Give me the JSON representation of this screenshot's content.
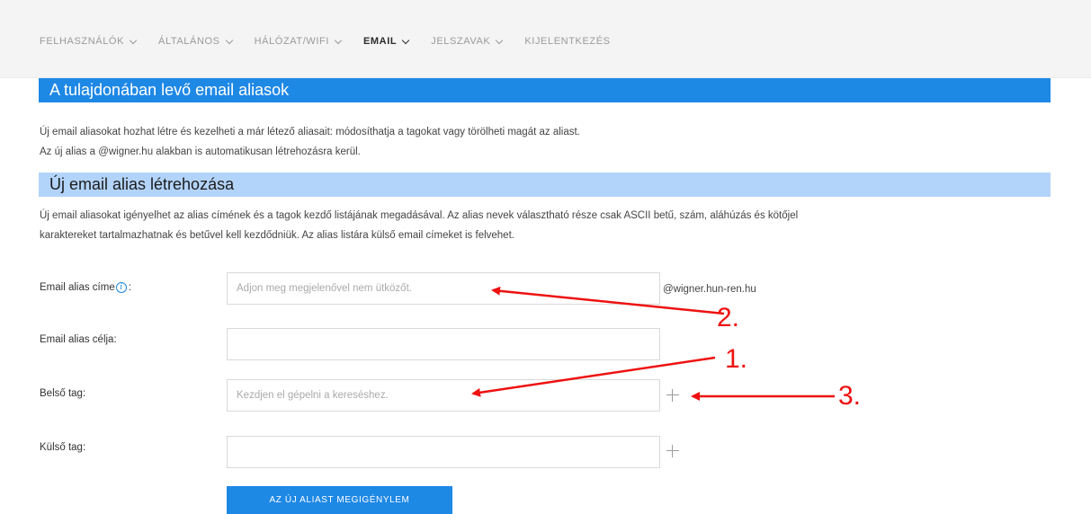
{
  "nav": {
    "items": [
      {
        "label": "FELHASZNÁLÓK",
        "active": false
      },
      {
        "label": "ÁLTALÁNOS",
        "active": false
      },
      {
        "label": "HÁLÓZAT/WIFI",
        "active": false
      },
      {
        "label": "EMAIL",
        "active": true
      },
      {
        "label": "JELSZAVAK",
        "active": false
      }
    ],
    "logout": "KIJELENTKEZÉS"
  },
  "section1": {
    "title": "A tulajdonában levő email aliasok",
    "desc1": "Új email aliasokat hozhat létre és kezelheti a már létező aliasait: módosíthatja a tagokat vagy törölheti magát az aliast.",
    "desc2": "Az új alias a @wigner.hu alakban is automatikusan létrehozásra kerül."
  },
  "section2": {
    "title": "Új email alias létrehozása",
    "desc1": "Új email aliasokat igényelhet az alias címének és a tagok kezdő listájának megadásával. Az alias nevek választható része csak ASCII betű, szám, aláhúzás és kötőjel",
    "desc2": "karaktereket tartalmazhatnak és betűvel kell kezdődniük. Az alias listára külső email címeket is felvehet."
  },
  "form": {
    "alias_label": "Email alias címe",
    "alias_label_colon": ":",
    "info_icon": "i",
    "alias_placeholder": "Adjon meg megjelenővel nem ütközőt.",
    "alias_value": "",
    "domain_suffix": "@wigner.hun-ren.hu",
    "purpose_label": "Email alias célja:",
    "purpose_value": "",
    "internal_label": "Belső tag:",
    "internal_placeholder": "Kezdjen el gépelni a kereséshez.",
    "internal_value": "",
    "external_label": "Külső tag:",
    "external_value": "",
    "submit_label": "AZ ÚJ ALIAST MEGIGÉNYLEM"
  },
  "annotations": {
    "label_1": "1.",
    "label_2": "2.",
    "label_3": "3."
  },
  "colors": {
    "primary": "#1e88e5",
    "light_bar": "#b3d4fa",
    "annotation": "#ee1111"
  },
  "icons": [
    "chevron-down-icon",
    "info-icon",
    "plus-icon"
  ]
}
